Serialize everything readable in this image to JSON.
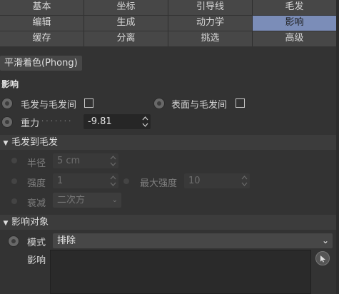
{
  "tabs": {
    "rows": [
      [
        "基本",
        "坐标",
        "引导线",
        "毛发"
      ],
      [
        "编辑",
        "生成",
        "动力学",
        "影响"
      ],
      [
        "缓存",
        "分离",
        "挑选",
        "高级"
      ]
    ],
    "active": "影响",
    "subtab": "平滑着色(Phong)"
  },
  "influence": {
    "section_title": "影响",
    "hair_to_hair_label": "毛发与毛发间",
    "surface_to_hair_label": "表面与毛发间",
    "gravity_label": "重力",
    "gravity_dots": ". . . . . . .",
    "gravity_value": "-9.81"
  },
  "hair_to_hair": {
    "header": "毛发到毛发",
    "radius_label": "半径",
    "radius_value": "5 cm",
    "strength_label": "强度",
    "strength_value": "1",
    "max_strength_label": "最大强度",
    "max_strength_value": "10",
    "falloff_label": "衰减",
    "falloff_value": "二次方"
  },
  "influence_objects": {
    "header": "影响对象",
    "mode_label": "模式",
    "mode_value": "排除",
    "influence_label": "影响"
  },
  "icons": {
    "spinner": "spinner-arrows-icon",
    "dropdown": "chevron-down-icon",
    "collapse": "triangle-down-icon",
    "picker": "pick-arrow-icon"
  }
}
